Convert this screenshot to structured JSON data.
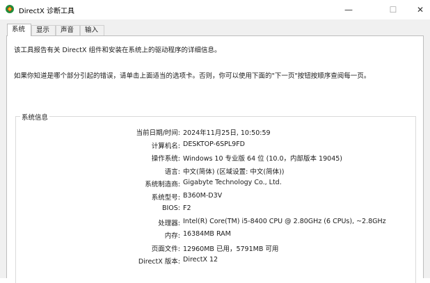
{
  "window": {
    "title": "DirectX 诊断工具",
    "controls": {
      "minimize": "—",
      "maximize": "☐",
      "close": "✕"
    }
  },
  "tabs": [
    {
      "label": "系统",
      "active": true
    },
    {
      "label": "显示",
      "active": false
    },
    {
      "label": "声音",
      "active": false
    },
    {
      "label": "输入",
      "active": false
    }
  ],
  "description": {
    "line1": "该工具报告有关 DirectX 组件和安装在系统上的驱动程序的详细信息。",
    "line2": "如果你知道是哪个部分引起的错误，请单击上面适当的选项卡。否则，你可以使用下面的\"下一页\"按钮按顺序查阅每一页。"
  },
  "system_info": {
    "group_title": "系统信息",
    "rows": [
      {
        "label": "当前日期/时间:",
        "value": "2024年11月25日, 10:50:59"
      },
      {
        "label": "计算机名:",
        "value": "DESKTOP-6SPL9FD"
      },
      {
        "label": "操作系统:",
        "value": "Windows 10 专业版 64 位 (10.0，内部版本 19045)"
      },
      {
        "label": "语言:",
        "value": "中文(简体) (区域设置: 中文(简体))"
      },
      {
        "label": "系统制造商:",
        "value": "Gigabyte Technology Co., Ltd."
      },
      {
        "label": "系统型号:",
        "value": "B360M-D3V"
      },
      {
        "label": "BIOS:",
        "value": "F2"
      },
      {
        "label": "处理器:",
        "value": "Intel(R) Core(TM) i5-8400 CPU @ 2.80GHz (6 CPUs), ~2.8GHz"
      },
      {
        "label": "内存:",
        "value": "16384MB RAM"
      },
      {
        "label": "页面文件:",
        "value": "12960MB 已用，5791MB 可用"
      },
      {
        "label": "DirectX 版本:",
        "value": "DirectX 12"
      }
    ]
  }
}
